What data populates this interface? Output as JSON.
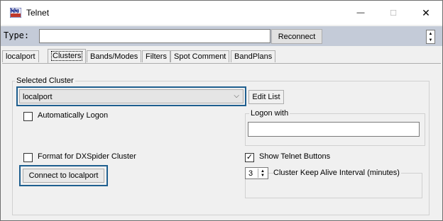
{
  "window": {
    "title": "Telnet",
    "minimize_glyph": "—",
    "maximize_glyph": "☐",
    "close_glyph": "✕"
  },
  "typebar": {
    "label": "Type:",
    "input_value": "",
    "reconnect_label": "Reconnect"
  },
  "tabs": [
    {
      "label": "localport"
    },
    {
      "label": "Clusters"
    },
    {
      "label": "Bands/Modes"
    },
    {
      "label": "Filters"
    },
    {
      "label": "Spot Comment"
    },
    {
      "label": "BandPlans"
    }
  ],
  "active_tab": "Clusters",
  "clusters": {
    "selected_cluster_legend": "Selected Cluster",
    "selected_cluster_value": "localport",
    "edit_list_label": "Edit List",
    "auto_logon_label": "Automatically Logon",
    "auto_logon_checked": false,
    "logon_with_legend": "Logon with",
    "logon_with_value": "",
    "format_dxspider_label": "Format for DXSpider Cluster",
    "format_dxspider_checked": false,
    "show_telnet_buttons_label": "Show Telnet Buttons",
    "show_telnet_buttons_checked": true,
    "connect_label": "Connect to localport",
    "keepalive_value": "3",
    "keepalive_label": "Cluster Keep Alive Interval (minutes)"
  },
  "colors": {
    "accent_highlight": "#1f5f8f",
    "typebar_bg": "#c4cbd8"
  }
}
